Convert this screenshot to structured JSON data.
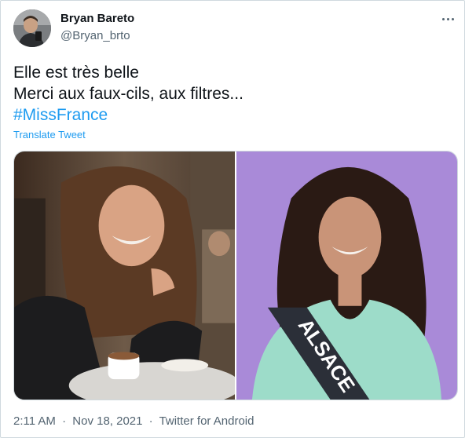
{
  "author": {
    "name": "Bryan Bareto",
    "handle": "@Bryan_brto",
    "avatar_icon": "user-avatar-photo"
  },
  "tweet": {
    "lines": [
      "Elle est très belle",
      "Merci aux faux-cils, aux filtres..."
    ],
    "hashtag": "#MissFrance",
    "translate_label": "Translate Tweet"
  },
  "media": {
    "images": [
      {
        "icon": "photo-woman-cafe"
      },
      {
        "icon": "photo-woman-sash"
      }
    ],
    "sash_text": "ALSACE"
  },
  "meta": {
    "time": "2:11 AM",
    "separator": "·",
    "date": "Nov 18, 2021",
    "source": "Twitter for Android"
  },
  "colors": {
    "link": "#1d9bf0",
    "secondary_text": "#536471",
    "border": "#cfd9de",
    "photo2_background": "#a98ad8"
  }
}
